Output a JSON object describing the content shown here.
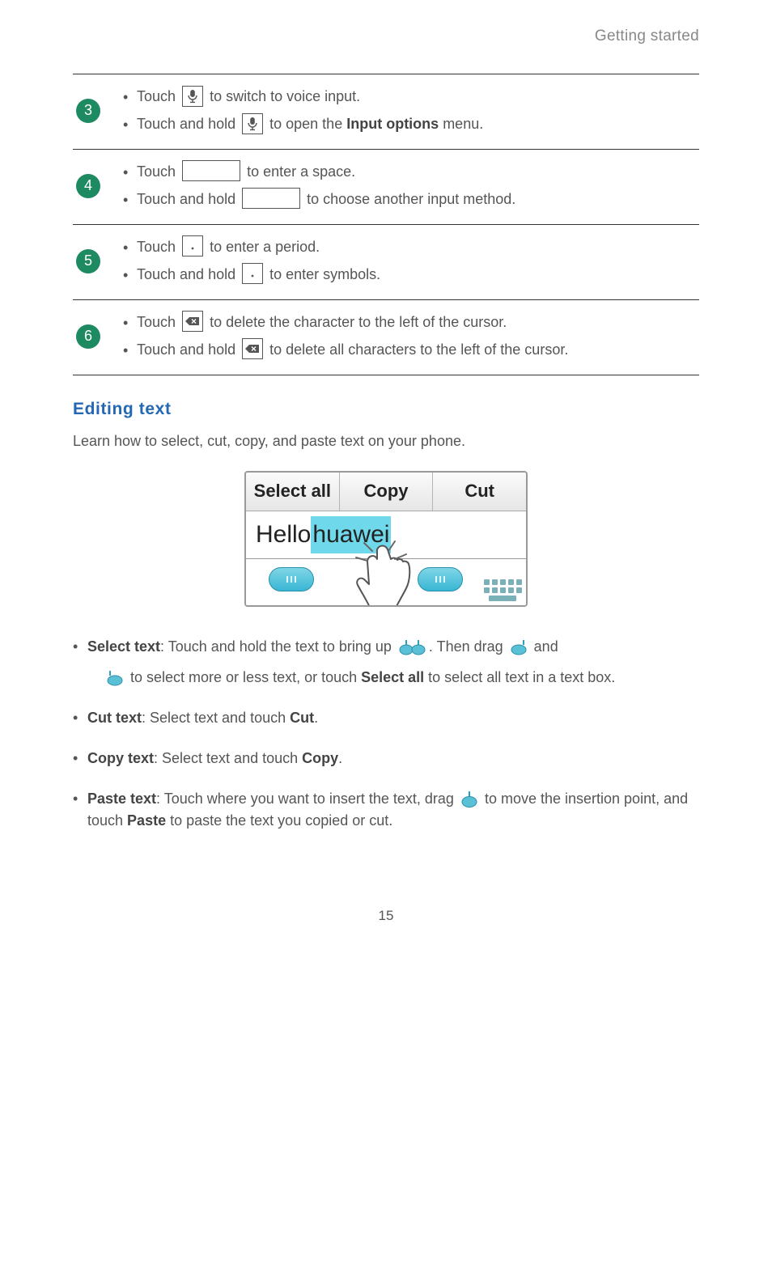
{
  "header": {
    "section": "Getting started"
  },
  "table": {
    "rows": [
      {
        "num": "3",
        "a_pre": "Touch ",
        "a_post": " to switch to voice input.",
        "b_pre": "Touch and hold ",
        "b_post": " to open the ",
        "b_strong": "Input options",
        "b_tail": " menu."
      },
      {
        "num": "4",
        "a_pre": "Touch ",
        "a_post": " to enter a space.",
        "b_pre": "Touch and hold ",
        "b_post": " to choose another input method."
      },
      {
        "num": "5",
        "a_pre": "Touch ",
        "a_post": " to enter a period.",
        "b_pre": "Touch and hold ",
        "b_post": " to enter symbols."
      },
      {
        "num": "6",
        "a_pre": "Touch ",
        "a_post": " to delete the character to the left of the cursor.",
        "b_pre": "Touch and hold ",
        "b_post": " to delete all characters to the left of the cursor."
      }
    ]
  },
  "editing": {
    "heading": "Editing text",
    "intro": "Learn how to select, cut, copy, and paste text on your phone."
  },
  "figure": {
    "toolbar": {
      "selectall": "Select all",
      "copy": "Copy",
      "cut": "Cut"
    },
    "text_plain": "Hello ",
    "text_sel_a": "h",
    "text_sel_b": "awei",
    "text_sel_mid": "u"
  },
  "features": {
    "select_label": "Select text",
    "select_a": ": Touch and hold the text to bring up ",
    "select_b": ". Then drag ",
    "select_c": " and",
    "select_sub_a": " to select more or less text, or touch ",
    "select_sub_strong": "Select all",
    "select_sub_b": " to select all text in a text box.",
    "cut_label": "Cut text",
    "cut_body": ": Select text and touch ",
    "cut_strong": "Cut",
    "cut_tail": ".",
    "copy_label": "Copy text",
    "copy_body": ": Select text and touch ",
    "copy_strong": "Copy",
    "copy_tail": ".",
    "paste_label": "Paste text",
    "paste_a": ": Touch where you want to insert the text, drag ",
    "paste_b": " to move the insertion point, and touch ",
    "paste_strong": "Paste",
    "paste_c": " to paste the text you copied or cut."
  },
  "page": {
    "num": "15"
  }
}
